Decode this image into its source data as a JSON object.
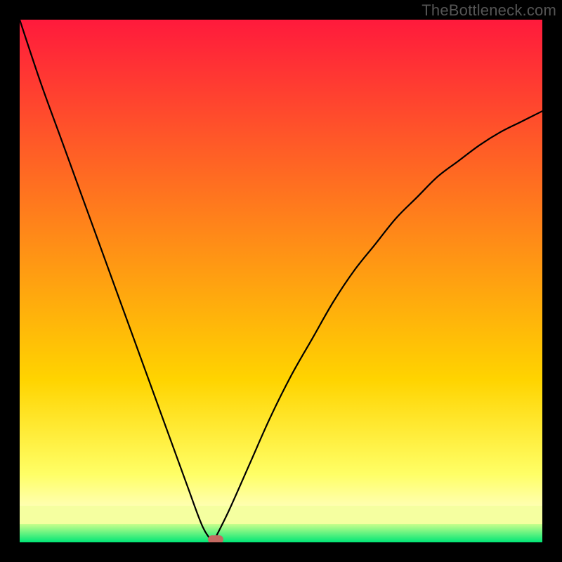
{
  "watermark": "TheBottleneck.com",
  "colors": {
    "top": "#ff1a3c",
    "mid_upper": "#ff7a2a",
    "mid": "#ffd400",
    "lower": "#ffff66",
    "pale": "#ffffb0",
    "green": "#00e676",
    "curve": "#000000",
    "marker": "#c46a62",
    "frame": "#000000"
  },
  "chart_data": {
    "type": "line",
    "title": "",
    "xlabel": "",
    "ylabel": "",
    "x_range": [
      0,
      100
    ],
    "y_range": [
      0,
      100
    ],
    "series": [
      {
        "name": "bottleneck-curve",
        "segments": [
          {
            "name": "left-branch",
            "x": [
              0,
              4,
              8,
              12,
              16,
              20,
              24,
              28,
              32,
              35,
              37
            ],
            "y": [
              100,
              88,
              77,
              66,
              55,
              44,
              33,
              22,
              11,
              3,
              0
            ]
          },
          {
            "name": "right-branch",
            "x": [
              37,
              40,
              44,
              48,
              52,
              56,
              60,
              64,
              68,
              72,
              76,
              80,
              84,
              88,
              92,
              96,
              100
            ],
            "y": [
              0,
              6,
              15,
              24,
              32,
              39,
              46,
              52,
              57,
              62,
              66,
              70,
              73,
              76,
              78.5,
              80.5,
              82.5
            ]
          }
        ]
      }
    ],
    "marker": {
      "x": 37.5,
      "y": 0.5,
      "name": "optimal-point"
    },
    "gradient_bands": [
      {
        "from": 0,
        "to": 69,
        "type": "smooth",
        "c0": "#ff1a3c",
        "c1": "#ffd400"
      },
      {
        "from": 69,
        "to": 87,
        "type": "smooth",
        "c0": "#ffd400",
        "c1": "#ffff66"
      },
      {
        "from": 87,
        "to": 93,
        "type": "smooth",
        "c0": "#ffff66",
        "c1": "#ffffb0"
      },
      {
        "from": 93,
        "to": 96.5,
        "type": "solid",
        "c0": "#f5ffa0"
      },
      {
        "from": 96.5,
        "to": 100,
        "type": "smooth",
        "c0": "#c8ff8c",
        "c1": "#00e676"
      }
    ]
  }
}
